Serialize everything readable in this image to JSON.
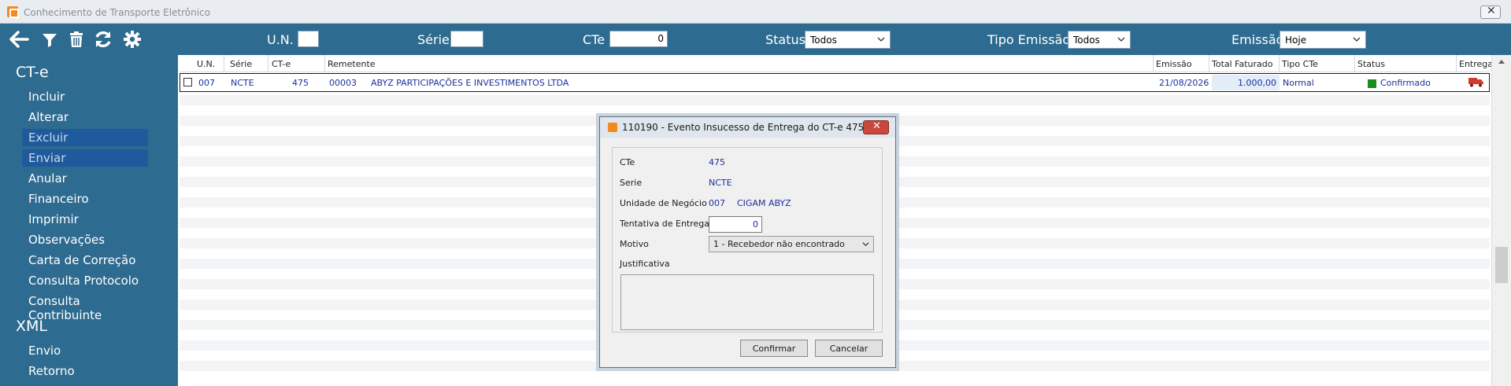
{
  "window": {
    "title": "Conhecimento de Transporte Eletrônico",
    "close_glyph": "✕"
  },
  "toolbar": {
    "un_label": "U.N.",
    "un_value": "",
    "serie_label": "Série",
    "serie_value": "",
    "cte_label": "CTe",
    "cte_value": "0",
    "status_label": "Status",
    "status_value": "Todos",
    "tipo_emissao_label": "Tipo Emissão",
    "tipo_emissao_value": "Todos",
    "emissao_label": "Emissão",
    "emissao_value": "Hoje",
    "icons": [
      "back-arrow-icon",
      "filter-icon",
      "trash-icon",
      "refresh-icon",
      "gear-icon"
    ]
  },
  "sidebar": {
    "cte_header": "CT-e",
    "cte_items": [
      "Incluir",
      "Alterar",
      "Excluir",
      "Enviar",
      "Anular",
      "Financeiro",
      "Imprimir",
      "Observações",
      "Carta de Correção",
      "Consulta Protocolo",
      "Consulta Contribuinte"
    ],
    "selected": [
      "Excluir",
      "Enviar"
    ],
    "xml_header": "XML",
    "xml_items": [
      "Envio",
      "Retorno"
    ]
  },
  "grid": {
    "columns": [
      "U.N.",
      "Série",
      "CT-e",
      "Remetente",
      "Emissão",
      "Total Faturado",
      "Tipo CTe",
      "Status",
      "Entrega"
    ],
    "rows": [
      {
        "un": "007",
        "serie": "NCTE",
        "cte": "475",
        "remetente_code": "00003",
        "remetente_name": "ABYZ PARTICIPAÇÕES E INVESTIMENTOS LTDA",
        "emissao": "21/08/2026",
        "total": "1.000,00",
        "tipo": "Normal",
        "status": "Confirmado",
        "status_color": "#1c8c1c",
        "entrega_icon": "delivery-truck-icon"
      }
    ]
  },
  "dialog": {
    "title": "110190 - Evento Insucesso de Entrega do CT-e 475",
    "close_glyph": "✕",
    "cte_label": "CTe",
    "cte_value": "475",
    "serie_label": "Serie",
    "serie_value": "NCTE",
    "un_label": "Unidade de Negócio",
    "un_code": "007",
    "un_name": "CIGAM ABYZ",
    "tentativa_label": "Tentativa de Entrega",
    "tentativa_value": "0",
    "motivo_label": "Motivo",
    "motivo_value": "1 - Recebedor não encontrado",
    "justificativa_label": "Justificativa",
    "justificativa_value": "",
    "confirm_label": "Confirmar",
    "cancel_label": "Cancelar"
  },
  "colors": {
    "toolbar_bg": "#2e6b90",
    "sidebar_selected": "#1f5a9c",
    "link_text": "#1a2fa0",
    "dialog_close": "#c9473b"
  }
}
